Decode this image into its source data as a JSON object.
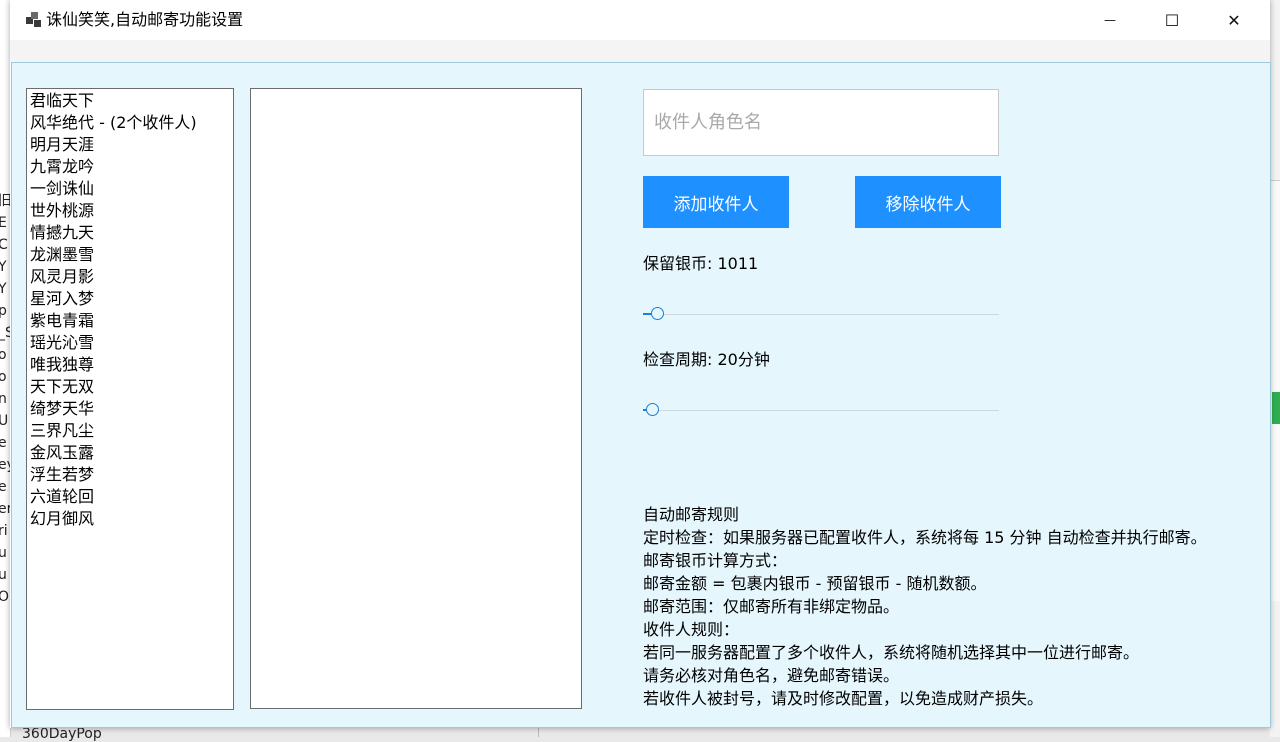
{
  "window": {
    "title": "诛仙笑笑,自动邮寄功能设置",
    "minimize_glyph": "—",
    "maximize_glyph": "☐",
    "close_glyph": "✕"
  },
  "server_list": [
    "君临天下",
    "风华绝代 - (2个收件人)",
    "明月天涯",
    "九霄龙吟",
    "一剑诛仙",
    "世外桃源",
    "情撼九天",
    "龙渊墨雪",
    "风灵月影",
    "星河入梦",
    "紫电青霜",
    "瑶光沁雪",
    "唯我独尊",
    "天下无双",
    "绮梦天华",
    "三界凡尘",
    "金风玉露",
    "浮生若梦",
    "六道轮回",
    "幻月御风"
  ],
  "recipient_input": {
    "placeholder": "收件人角色名",
    "value": ""
  },
  "buttons": {
    "add": "添加收件人",
    "remove": "移除收件人"
  },
  "silver_reserve": {
    "label": "保留银币: 1011",
    "fraction": 0.04
  },
  "check_period": {
    "label": "检查周期: 20分钟",
    "fraction": 0.025
  },
  "rules": [
    "自动邮寄规则",
    "定时检查：如果服务器已配置收件人，系统将每 15 分钟 自动检查并执行邮寄。",
    "邮寄银币计算方式：",
    "邮寄金额 = 包裹内银币 - 预留银币 - 随机数额。",
    "邮寄范围：仅邮寄所有非绑定物品。",
    "收件人规则：",
    "若同一服务器配置了多个收件人，系统将随机选择其中一位进行邮寄。",
    "请务必核对角色名，避免邮寄错误。",
    "若收件人被封号，请及时修改配置，以免造成财产损失。"
  ],
  "background": {
    "left_fragments": [
      "旧",
      "E",
      "C",
      "Y",
      "Y",
      "p",
      "_S",
      "o",
      "o",
      "n",
      "U",
      "e",
      "ey",
      "e",
      "er",
      "ri",
      "u",
      "u",
      "O"
    ],
    "bottom_text": "360DayPop"
  },
  "colors": {
    "accent": "#1e90ff",
    "client_bg": "#e5f6fd"
  }
}
